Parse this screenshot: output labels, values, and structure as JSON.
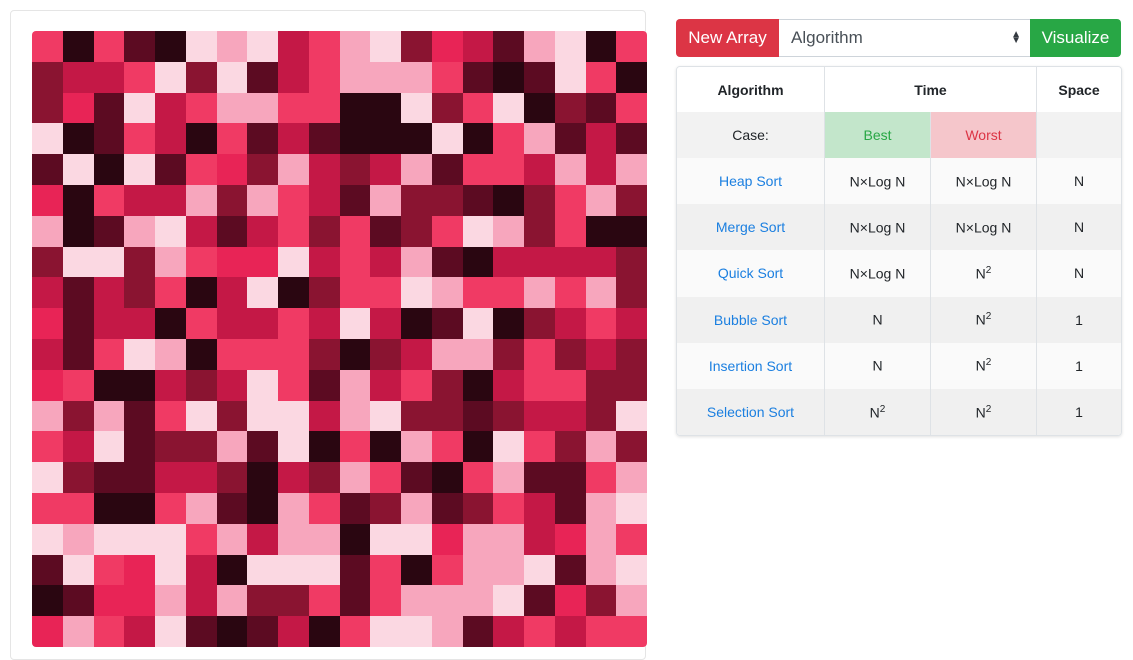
{
  "controls": {
    "new_array_label": "New Array",
    "algorithm_select_value": "Algorithm",
    "visualize_label": "Visualize"
  },
  "table": {
    "headers": {
      "algorithm": "Algorithm",
      "time": "Time",
      "space": "Space"
    },
    "case_row": {
      "label": "Case:",
      "best": "Best",
      "worst": "Worst"
    },
    "rows": [
      {
        "name": "Heap Sort",
        "best": "N×Log N",
        "best_sup": "",
        "worst": "N×Log N",
        "worst_sup": "",
        "space": "N"
      },
      {
        "name": "Merge Sort",
        "best": "N×Log N",
        "best_sup": "",
        "worst": "N×Log N",
        "worst_sup": "",
        "space": "N"
      },
      {
        "name": "Quick Sort",
        "best": "N×Log N",
        "best_sup": "",
        "worst": "N",
        "worst_sup": "2",
        "space": "N"
      },
      {
        "name": "Bubble Sort",
        "best": "N",
        "best_sup": "",
        "worst": "N",
        "worst_sup": "2",
        "space": "1"
      },
      {
        "name": "Insertion Sort",
        "best": "N",
        "best_sup": "",
        "worst": "N",
        "worst_sup": "2",
        "space": "1"
      },
      {
        "name": "Selection Sort",
        "best": "N",
        "best_sup": "2",
        "worst": "N",
        "worst_sup": "2",
        "space": "1"
      }
    ]
  },
  "grid": {
    "palette": [
      "#f03a64",
      "#c41846",
      "#8a1431",
      "#5c0b22",
      "#2a0611",
      "#f7a6bd",
      "#fbd8e2",
      "#e82456"
    ],
    "cells": [
      [
        0,
        4,
        0,
        3,
        4,
        6,
        5,
        6,
        1,
        0,
        5,
        6,
        2,
        7,
        1,
        3,
        5,
        6,
        4,
        0
      ],
      [
        2,
        1,
        1,
        0,
        6,
        2,
        6,
        3,
        1,
        0,
        5,
        5,
        5,
        0,
        3,
        4,
        3,
        6,
        0,
        4
      ],
      [
        2,
        7,
        3,
        6,
        1,
        0,
        5,
        5,
        0,
        0,
        4,
        4,
        6,
        2,
        0,
        6,
        4,
        2,
        3,
        0
      ],
      [
        6,
        4,
        3,
        0,
        1,
        4,
        0,
        3,
        1,
        3,
        4,
        4,
        4,
        6,
        4,
        0,
        5,
        3,
        1,
        3
      ],
      [
        3,
        6,
        4,
        6,
        3,
        0,
        7,
        2,
        5,
        1,
        2,
        1,
        5,
        3,
        0,
        0,
        1,
        5,
        1,
        5
      ],
      [
        7,
        4,
        0,
        1,
        1,
        5,
        2,
        5,
        0,
        1,
        3,
        5,
        2,
        2,
        3,
        4,
        2,
        0,
        5,
        2
      ],
      [
        5,
        4,
        3,
        5,
        6,
        1,
        3,
        1,
        0,
        2,
        0,
        3,
        2,
        0,
        6,
        5,
        2,
        0,
        4,
        4
      ],
      [
        2,
        6,
        6,
        2,
        5,
        0,
        7,
        7,
        6,
        1,
        0,
        1,
        5,
        3,
        4,
        1,
        1,
        1,
        1,
        2
      ],
      [
        1,
        3,
        1,
        2,
        0,
        4,
        1,
        6,
        4,
        2,
        0,
        0,
        6,
        5,
        0,
        0,
        5,
        0,
        5,
        2
      ],
      [
        7,
        3,
        1,
        1,
        4,
        0,
        1,
        1,
        0,
        1,
        6,
        1,
        4,
        3,
        6,
        4,
        2,
        1,
        0,
        1
      ],
      [
        1,
        3,
        0,
        6,
        5,
        4,
        0,
        0,
        0,
        2,
        4,
        2,
        1,
        5,
        5,
        2,
        0,
        2,
        1,
        2
      ],
      [
        7,
        0,
        4,
        4,
        1,
        2,
        1,
        6,
        0,
        3,
        5,
        1,
        0,
        2,
        4,
        1,
        0,
        0,
        2,
        2
      ],
      [
        5,
        2,
        5,
        3,
        0,
        6,
        2,
        6,
        6,
        1,
        5,
        6,
        2,
        2,
        3,
        2,
        1,
        1,
        2,
        6
      ],
      [
        0,
        1,
        6,
        3,
        2,
        2,
        5,
        3,
        6,
        4,
        0,
        4,
        5,
        0,
        4,
        6,
        0,
        2,
        5,
        2
      ],
      [
        6,
        2,
        3,
        3,
        1,
        1,
        2,
        4,
        1,
        2,
        5,
        0,
        3,
        4,
        0,
        5,
        3,
        3,
        0,
        5
      ],
      [
        0,
        0,
        4,
        4,
        0,
        5,
        3,
        4,
        5,
        0,
        3,
        2,
        5,
        3,
        2,
        0,
        1,
        3,
        5,
        6
      ],
      [
        6,
        5,
        6,
        6,
        6,
        0,
        5,
        1,
        5,
        5,
        4,
        6,
        6,
        7,
        5,
        5,
        1,
        7,
        5,
        0
      ],
      [
        3,
        6,
        0,
        7,
        6,
        1,
        4,
        6,
        6,
        6,
        3,
        0,
        4,
        0,
        5,
        5,
        6,
        3,
        5,
        6
      ],
      [
        4,
        3,
        7,
        7,
        5,
        1,
        5,
        2,
        2,
        0,
        3,
        0,
        5,
        5,
        5,
        6,
        3,
        7,
        2,
        5
      ],
      [
        7,
        5,
        0,
        1,
        6,
        3,
        4,
        3,
        1,
        4,
        0,
        6,
        6,
        5,
        3,
        1,
        0,
        1,
        0,
        0
      ]
    ]
  }
}
